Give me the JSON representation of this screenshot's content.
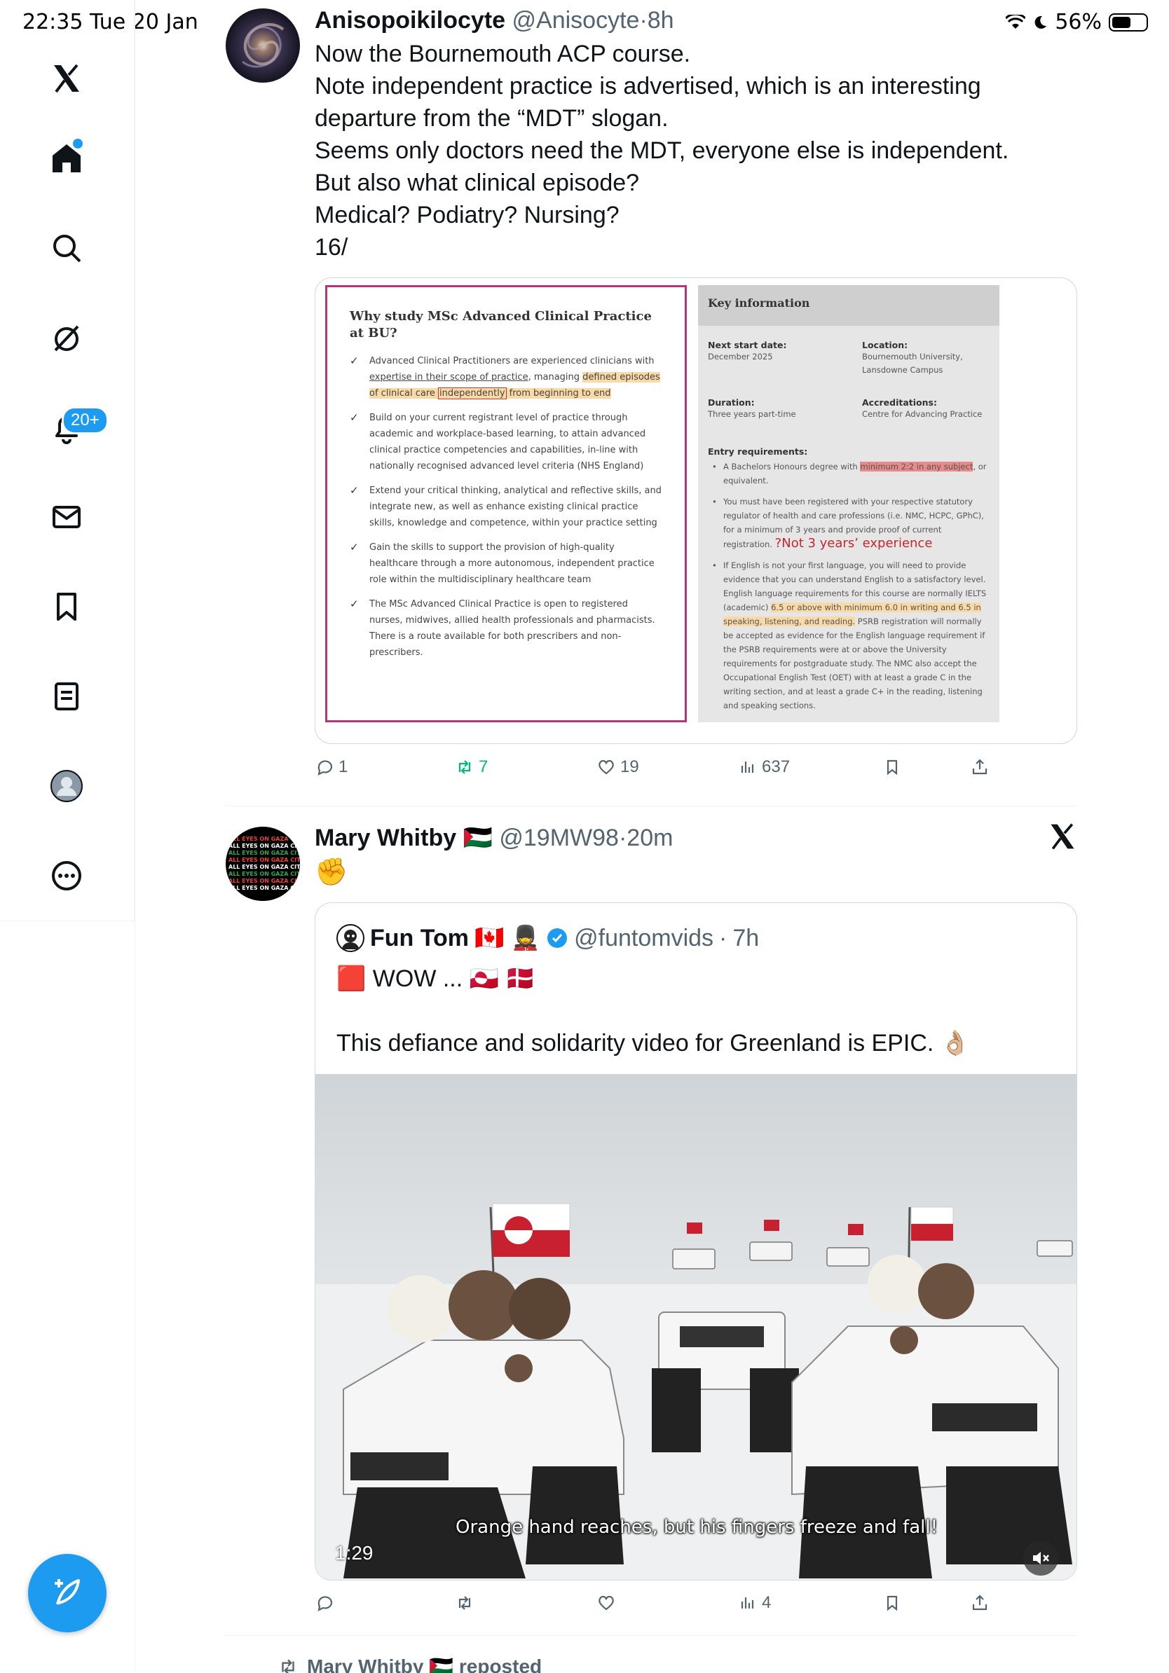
{
  "status": {
    "time_date": "22:35  Tue 20 Jan",
    "battery": "56%",
    "battery_fraction": 0.56
  },
  "sidebar": {
    "notifications_badge": "20+",
    "items": [
      "X logo",
      "Home",
      "Search",
      "Grok",
      "Notifications",
      "Messages",
      "Bookmarks",
      "Lists",
      "Profile",
      "More"
    ]
  },
  "tweet1": {
    "name": "Anisopoikilocyte",
    "handle": "@Anisocyte",
    "time": "8h",
    "lines": [
      "Now the Bournemouth ACP course.",
      "Note independent practice is advertised, which is an interesting",
      "departure from the “MDT” slogan.",
      "Seems only doctors need the MDT, everyone else is independent.",
      "But also what clinical episode?",
      "Medical? Podiatry? Nursing?",
      "16/"
    ],
    "doc": {
      "left_title": "Why study MSc Advanced Clinical Practice at BU?",
      "item1_a": "Advanced Clinical Practitioners are experienced clinicians with ",
      "item1_b": "expertise in their scope of practice",
      "item1_c": ", managing ",
      "item1_d": "defined episodes of clinical care ",
      "item1_e": "independently",
      "item1_f": " from beginning to end",
      "item2": "Build on your current registrant level of practice through academic and workplace-based learning, to attain advanced clinical practice competencies and capabilities, in-line with nationally recognised advanced level criteria (NHS England)",
      "item3": "Extend your critical thinking, analytical and reflective skills, and integrate new, as well as enhance existing clinical practice skills, knowledge and competence, within your practice setting",
      "item4": "Gain the skills to support the provision of high-quality healthcare through a more autonomous, independent practice role within the multidisciplinary healthcare team",
      "item5": "The MSc Advanced Clinical Practice is open to registered nurses, midwives, allied health professionals and pharmacists. There is a route available for both prescribers and non-prescribers.",
      "key_title": "Key information",
      "next_start_label": "Next start date:",
      "next_start_value": "December 2025",
      "location_label": "Location:",
      "location_value": "Bournemouth University, Lansdowne Campus",
      "duration_label": "Duration:",
      "duration_value": "Three years part-time",
      "accred_label": "Accreditations:",
      "accred_value": "Centre for Advancing Practice",
      "entry_label": "Entry requirements:",
      "entry1_a": "A Bachelors Honours degree with ",
      "entry1_b": "minimum 2:2 in any subject",
      "entry1_c": ", or equivalent.",
      "entry2": "You must have been registered with your respective statutory regulator of health and care professions (i.e. NMC, HCPC, GPhC), for a minimum of 3 years and provide proof of current registration.",
      "entry2_annotation": "?Not 3 years’ experience",
      "entry3_a": "If English is not your first language, you will need to provide evidence that you can understand English to a satisfactory level. English language requirements for this course are normally IELTS (academic) ",
      "entry3_b": "6.5 or above with minimum 6.0 in writing and 6.5 in speaking, listening, and reading.",
      "entry3_c": " PSRB registration will normally be accepted as evidence for the English language requirement if the PSRB requirements were at or above the University requirements for postgraduate study. The NMC also accept the Occupational English Test (OET) with at least a grade C in the writing section, and at least a grade C+ in the reading, listening and speaking sections."
    },
    "replies": "1",
    "reposts": "7",
    "likes": "19",
    "views": "637"
  },
  "tweet2": {
    "name": "Mary Whitby",
    "name_flag": "🇵🇸",
    "handle": "@19MW98",
    "time": "20m",
    "text": "✊",
    "avatar_text": "ALL EYES ON GAZA CITY",
    "quote": {
      "name": "Fun Tom",
      "name_emoji": "🇨🇦 💂",
      "handle": "@funtomvids",
      "time": "7h",
      "line1": "🟥  WOW ... 🇬🇱 🇩🇰",
      "line2": "This defiance and solidarity video for Greenland is EPIC. 👌🏼",
      "video_caption": "Orange hand reaches, but his fingers freeze and fall!",
      "video_time": "1:29"
    },
    "replies": "",
    "reposts": "",
    "likes": "",
    "views": "4"
  },
  "tweet3": {
    "repost_label": "Mary Whitby 🇵🇸 reposted"
  },
  "colors": {
    "accent": "#1d9bf0",
    "repost_green": "#00ba7c",
    "text": "#0f1419",
    "muted": "#536471"
  }
}
